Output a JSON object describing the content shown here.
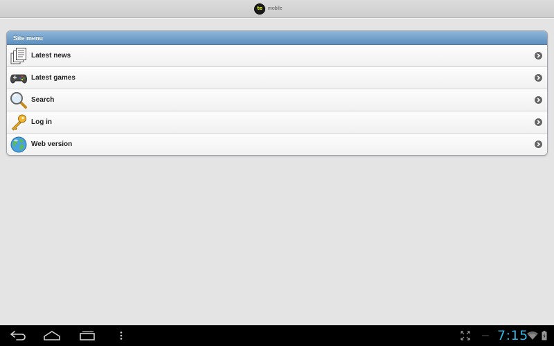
{
  "header": {
    "logo_badge_text": "te",
    "logo_text": "mobile"
  },
  "site_menu": {
    "title": "Site menu",
    "items": [
      {
        "label": "Latest news",
        "icon": "news-icon"
      },
      {
        "label": "Latest games",
        "icon": "gamepad-icon"
      },
      {
        "label": "Search",
        "icon": "magnifier-icon"
      },
      {
        "label": "Log in",
        "icon": "key-icon"
      },
      {
        "label": "Web version",
        "icon": "globe-icon"
      }
    ]
  },
  "status_bar": {
    "time": "7:15"
  },
  "colors": {
    "accent_blue": "#33b5e5",
    "menu_header": "#5d8fbf",
    "background": "#e4e4e4"
  }
}
